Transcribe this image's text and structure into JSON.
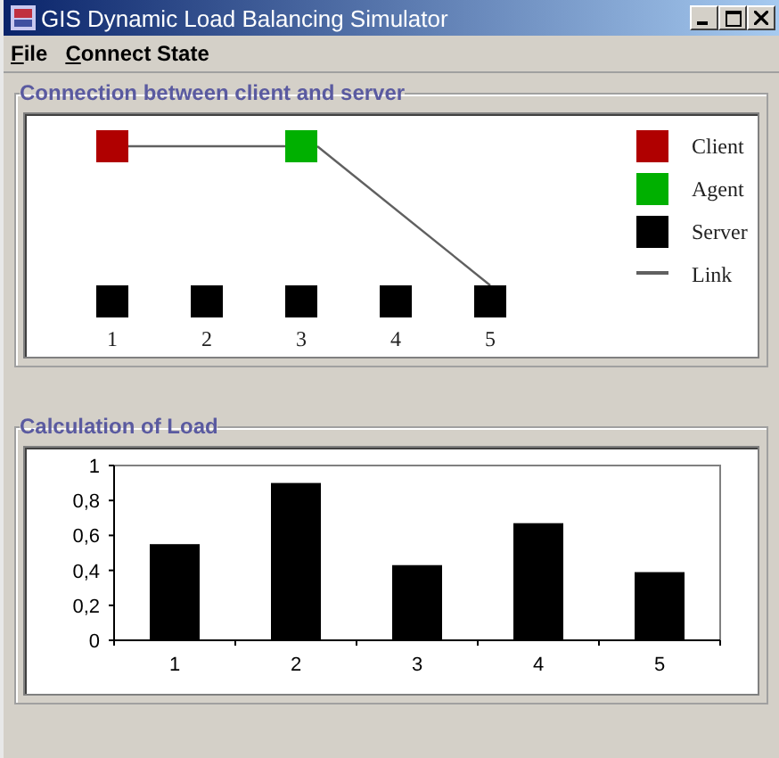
{
  "window": {
    "title": "GIS Dynamic Load Balancing Simulator"
  },
  "menu": [
    {
      "label": "File"
    },
    {
      "label": "Connect State"
    }
  ],
  "connection": {
    "title": "Connection between client and server",
    "servers": [
      {
        "label": "1",
        "client": true,
        "agent": false,
        "linked": false
      },
      {
        "label": "2",
        "client": false,
        "agent": false,
        "linked": false
      },
      {
        "label": "3",
        "client": false,
        "agent": true,
        "linked": false
      },
      {
        "label": "4",
        "client": false,
        "agent": false,
        "linked": false
      },
      {
        "label": "5",
        "client": false,
        "agent": false,
        "linked": true
      }
    ],
    "legend": [
      {
        "kind": "square",
        "label": "Client",
        "color": "#b00000"
      },
      {
        "kind": "square",
        "label": "Agent",
        "color": "#00b000"
      },
      {
        "kind": "square",
        "label": "Server",
        "color": "#000000"
      },
      {
        "kind": "line",
        "label": "Link",
        "color": "#606060"
      }
    ]
  },
  "load": {
    "title": "Calculation of Load",
    "chart_data": {
      "type": "bar",
      "categories": [
        "1",
        "2",
        "3",
        "4",
        "5"
      ],
      "series": [
        {
          "color": "#000000",
          "values": [
            0.55,
            0.9,
            0.43,
            0.67,
            0.39
          ]
        }
      ],
      "ylim": [
        0,
        1
      ],
      "yticks": [
        {
          "value": 0,
          "label": "0"
        },
        {
          "value": 0.2,
          "label": "0,2"
        },
        {
          "value": 0.4,
          "label": "0,4"
        },
        {
          "value": 0.6,
          "label": "0,6"
        },
        {
          "value": 0.8,
          "label": "0,8"
        },
        {
          "value": 1,
          "label": "1"
        }
      ]
    }
  }
}
